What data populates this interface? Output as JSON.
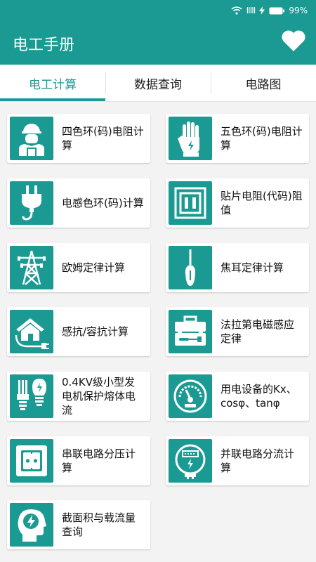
{
  "status": {
    "signal_icon": "wifi-icon",
    "carrier": "IIIII",
    "charging_icon": "lightning-icon",
    "battery": "99%"
  },
  "header": {
    "title": "电工手册",
    "favorite_icon": "heart-icon"
  },
  "tabs": [
    {
      "label": "电工计算"
    },
    {
      "label": "数据查询"
    },
    {
      "label": "电路图"
    }
  ],
  "items": [
    {
      "label": "四色环(码)电阻计算",
      "icon": "worker-icon"
    },
    {
      "label": "五色环(码)电阻计算",
      "icon": "glove-icon"
    },
    {
      "label": "电感色环(码)计算",
      "icon": "plug-icon"
    },
    {
      "label": "贴片电阻(代码)阻值",
      "icon": "chip-resistor-icon"
    },
    {
      "label": "欧姆定律计算",
      "icon": "power-tower-icon"
    },
    {
      "label": "焦耳定律计算",
      "icon": "screwdriver-icon"
    },
    {
      "label": "感抗/容抗计算",
      "icon": "house-plug-icon"
    },
    {
      "label": "法拉第电磁感应定律",
      "icon": "toolbox-icon"
    },
    {
      "label": "0.4KV级小型发电机保护熔体电流",
      "icon": "bulbs-icon"
    },
    {
      "label": "用电设备的Kx、cosφ、tanφ",
      "icon": "gauge-icon"
    },
    {
      "label": "串联电路分压计算",
      "icon": "socket-icon"
    },
    {
      "label": "并联电路分流计算",
      "icon": "meter-icon"
    },
    {
      "label": "截面积与载流量查询",
      "icon": "head-bolt-icon"
    }
  ],
  "colors": {
    "accent": "#1a9a93",
    "background": "#f3f3f3"
  }
}
